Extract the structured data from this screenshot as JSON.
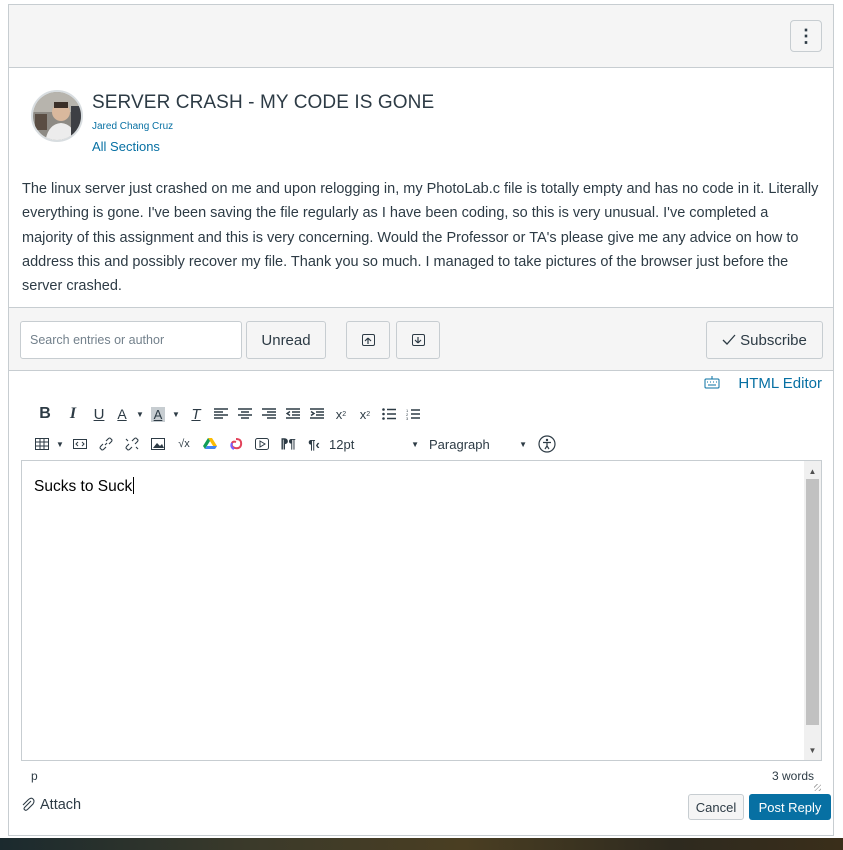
{
  "post": {
    "title": "SERVER CRASH - MY CODE IS GONE",
    "author": "Jared Chang Cruz",
    "sections": "All Sections",
    "body": "The linux server just crashed on me and upon relogging in, my PhotoLab.c file is totally empty and has no code in it. Literally everything is gone. I've been saving the file regularly as I have been coding, so this is very unusual. I've completed a majority of this assignment and this is very concerning. Would the Professor or TA's please give me any advice on how to address this and possibly recover my file. Thank you so much. I managed to take pictures of the browser just before the server crashed."
  },
  "toolbar": {
    "search_placeholder": "Search entries or author",
    "unread_label": "Unread",
    "subscribe_label": "Subscribe"
  },
  "editor": {
    "html_editor_label": "HTML Editor",
    "font_size": "12pt",
    "block_format": "Paragraph",
    "content": "Sucks to Suck",
    "path": "p",
    "word_count": "3 words"
  },
  "actions": {
    "attach_label": "Attach",
    "cancel_label": "Cancel",
    "post_reply_label": "Post Reply"
  },
  "colors": {
    "link": "#0770a3",
    "primary_button": "#0770a3",
    "text": "#2d3b45",
    "border": "#c7cdd1",
    "panel": "#f5f5f5"
  }
}
